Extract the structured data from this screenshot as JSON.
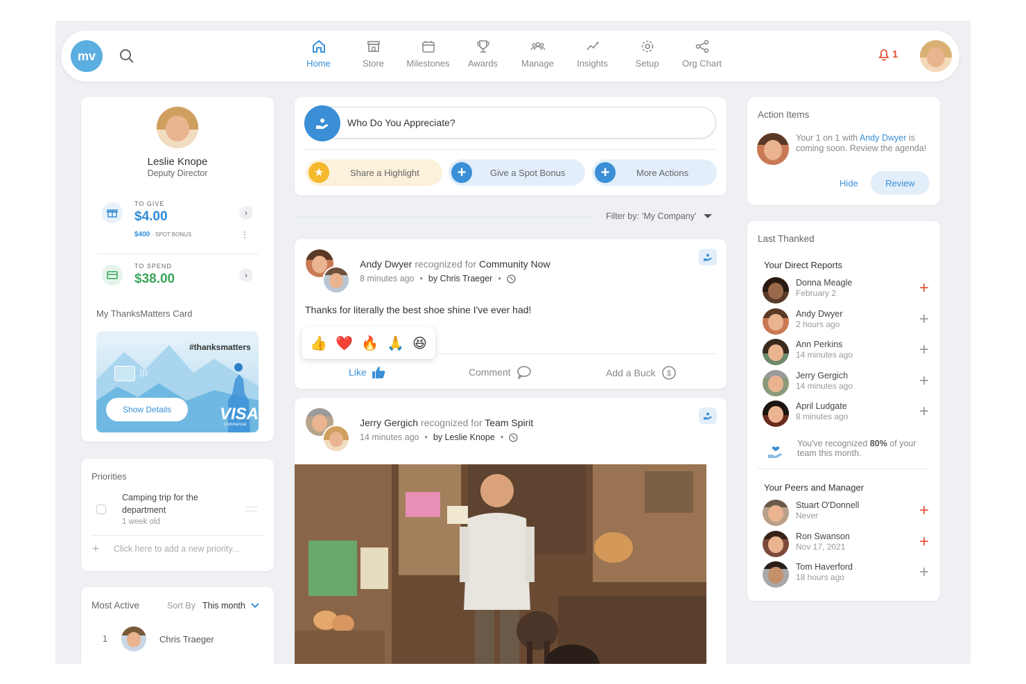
{
  "nav": {
    "logo_text": "mv",
    "items": [
      {
        "label": "Home",
        "icon": "home-icon",
        "active": true
      },
      {
        "label": "Store",
        "icon": "store-icon",
        "active": false
      },
      {
        "label": "Milestones",
        "icon": "calendar-icon",
        "active": false
      },
      {
        "label": "Awards",
        "icon": "trophy-icon",
        "active": false
      },
      {
        "label": "Manage",
        "icon": "people-icon",
        "active": false
      },
      {
        "label": "Insights",
        "icon": "insights-icon",
        "active": false
      },
      {
        "label": "Setup",
        "icon": "gear-icon",
        "active": false
      },
      {
        "label": "Org Chart",
        "icon": "share-icon",
        "active": false
      }
    ],
    "notification_count": "1"
  },
  "profile": {
    "name": "Leslie Knope",
    "title": "Deputy Director",
    "to_give_label": "TO GIVE",
    "to_give_amount": "$4.00",
    "spot_bonus_amount": "$400",
    "spot_bonus_label": "· SPOT BONUS",
    "to_spend_label": "TO SPEND",
    "to_spend_amount": "$38.00",
    "card_label": "My ThanksMatters Card",
    "card_hashtag": "#thanksmatters",
    "card_button": "Show Details",
    "card_brand": "VISA",
    "card_brand_sub": "Commercial"
  },
  "priorities": {
    "title": "Priorities",
    "items": [
      {
        "text": "Camping trip for the department",
        "age": "1 week old"
      }
    ],
    "add_placeholder": "Click here to add a new priority..."
  },
  "most_active": {
    "title": "Most Active",
    "sort_label": "Sort By",
    "sort_value": "This month",
    "rows": [
      {
        "rank": "1",
        "name": "Chris Traeger"
      }
    ]
  },
  "composer": {
    "prompt": "Who Do You Appreciate?",
    "actions": [
      "Share a Highlight",
      "Give a Spot Bonus",
      "More Actions"
    ]
  },
  "filter": {
    "label": "Filter by:",
    "value": "'My Company'"
  },
  "posts": [
    {
      "recipient": "Andy Dwyer",
      "verb": "recognized for",
      "value": "Community Now",
      "time": "8 minutes ago",
      "by": "by Chris Traeger",
      "text": "Thanks for literally the best shoe shine I've ever had!",
      "reactions": [
        "👍",
        "❤️",
        "🔥",
        "🙏",
        "😆"
      ],
      "like_label": "Like",
      "comment_label": "Comment",
      "buck_label": "Add a Buck"
    },
    {
      "recipient": "Jerry Gergich",
      "verb": "recognized for",
      "value": "Team Spirit",
      "time": "14 minutes ago",
      "by": "by Leslie Knope"
    }
  ],
  "action_items": {
    "title": "Action Items",
    "text_before": "Your 1 on 1 with",
    "link_name": "Andy Dwyer",
    "text_after": "is coming soon. Review the agenda!",
    "hide_label": "Hide",
    "review_label": "Review"
  },
  "last_thanked": {
    "title": "Last Thanked",
    "direct_reports_title": "Your Direct Reports",
    "direct_reports": [
      {
        "name": "Donna Meagle",
        "when": "February 2",
        "highlight": true
      },
      {
        "name": "Andy Dwyer",
        "when": "2 hours ago",
        "highlight": false
      },
      {
        "name": "Ann Perkins",
        "when": "14 minutes ago",
        "highlight": false
      },
      {
        "name": "Jerry Gergich",
        "when": "14 minutes ago",
        "highlight": false
      },
      {
        "name": "April Ludgate",
        "when": "8 minutes ago",
        "highlight": false
      }
    ],
    "recognized_text_before": "You've recognized",
    "recognized_percent": "80%",
    "recognized_text_after": "of your team this month.",
    "peers_title": "Your Peers and Manager",
    "peers": [
      {
        "name": "Stuart O'Donnell",
        "when": "Never",
        "highlight": true
      },
      {
        "name": "Ron Swanson",
        "when": "Nov 17, 2021",
        "highlight": true
      },
      {
        "name": "Tom Haverford",
        "when": "18 hours ago",
        "highlight": false
      }
    ]
  },
  "colors": {
    "accent": "#3a8fd6",
    "alert": "#e0533a",
    "green": "#3aa55a",
    "page_bg": "#eef0f4"
  }
}
